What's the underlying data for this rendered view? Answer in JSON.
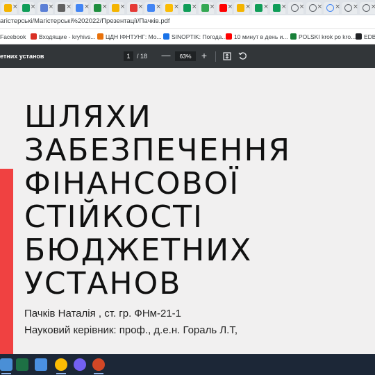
{
  "browser": {
    "tabs": [
      {
        "icon": "google-drive-icon",
        "color": "#f4b400"
      },
      {
        "icon": "google-drive-icon",
        "color": "#0f9d58"
      },
      {
        "icon": "google-docs-icon",
        "color": "#5b7fd6"
      },
      {
        "icon": "document-icon",
        "color": "#616161"
      },
      {
        "icon": "mail-icon",
        "color": "#4285f4"
      },
      {
        "icon": "classroom-icon",
        "color": "#1e8e3e"
      },
      {
        "icon": "classroom-icon",
        "color": "#f4b400"
      },
      {
        "icon": "school-icon",
        "color": "#e53935"
      },
      {
        "icon": "google-drive-icon",
        "color": "#4285f4"
      },
      {
        "icon": "google-drive-icon",
        "color": "#fbbc04"
      },
      {
        "icon": "google-sheets-icon",
        "color": "#0f9d58"
      },
      {
        "icon": "google-drive-icon",
        "color": "#34a853"
      },
      {
        "icon": "youtube-icon",
        "color": "#ff0000"
      },
      {
        "icon": "classroom-icon",
        "color": "#f4b400"
      },
      {
        "icon": "google-sheets-icon",
        "color": "#0f9d58"
      },
      {
        "icon": "google-sheets-icon",
        "color": "#0f9d58"
      },
      {
        "icon": "globe-icon",
        "color": "#5f6368"
      },
      {
        "icon": "globe-icon",
        "color": "#5f6368"
      },
      {
        "icon": "google-icon",
        "color": "#4285f4"
      },
      {
        "icon": "circle-icon",
        "color": "#5f6368"
      },
      {
        "icon": "globe-icon",
        "color": "#5f6368"
      }
    ],
    "url": "агістерські/Магістерські%202022/Презентації/Пачків.pdf",
    "bookmarks": [
      {
        "label": "Facebook",
        "icon": "facebook-icon",
        "color": "#1877f2"
      },
      {
        "label": "Входящие - kryhivs...",
        "icon": "gmail-icon",
        "color": "#d93025"
      },
      {
        "label": "ЦДН ІФНТУНГ: Мо...",
        "icon": "university-icon",
        "color": "#e8710a"
      },
      {
        "label": "SINOPTIK: Погода...",
        "icon": "weather-icon",
        "color": "#1a73e8"
      },
      {
        "label": "10 минут в день и...",
        "icon": "youtube-icon",
        "color": "#ff0000"
      },
      {
        "label": "POLSKI krok po kro...",
        "icon": "book-icon",
        "color": "#188038"
      },
      {
        "label": "EDBO",
        "icon": "globe-icon",
        "color": "#202124"
      }
    ]
  },
  "pdf_viewer": {
    "doc_title": "етних установ",
    "current_page": "1",
    "total_pages": "/ 18",
    "zoom_out": "—",
    "zoom": "63%",
    "zoom_in": "+"
  },
  "slide": {
    "title_lines": [
      "ШЛЯХИ",
      "ЗАБЕЗПЕЧЕННЯ",
      "ФІНАНСОВОЇ",
      "СТІЙКОСТІ",
      "БЮДЖЕТНИХ",
      "УСТАНОВ"
    ],
    "author": "Пачків Наталія , ст. гр. ФНм-21-1",
    "supervisor": "Науковий керівник:  проф., д.е.н. Гораль Л.Т,",
    "accent_color": "#f04141"
  },
  "taskbar": {
    "apps": [
      {
        "icon": "explorer-icon",
        "color": "#4a8fd6"
      },
      {
        "icon": "excel-icon",
        "color": "#1d7044"
      },
      {
        "icon": "onedrive-icon",
        "color": "#4a90e2"
      },
      {
        "icon": "chrome-icon",
        "color": "#fbbc04"
      },
      {
        "icon": "viber-icon",
        "color": "#7360f2"
      },
      {
        "icon": "powerpoint-icon",
        "color": "#d24726"
      }
    ]
  }
}
